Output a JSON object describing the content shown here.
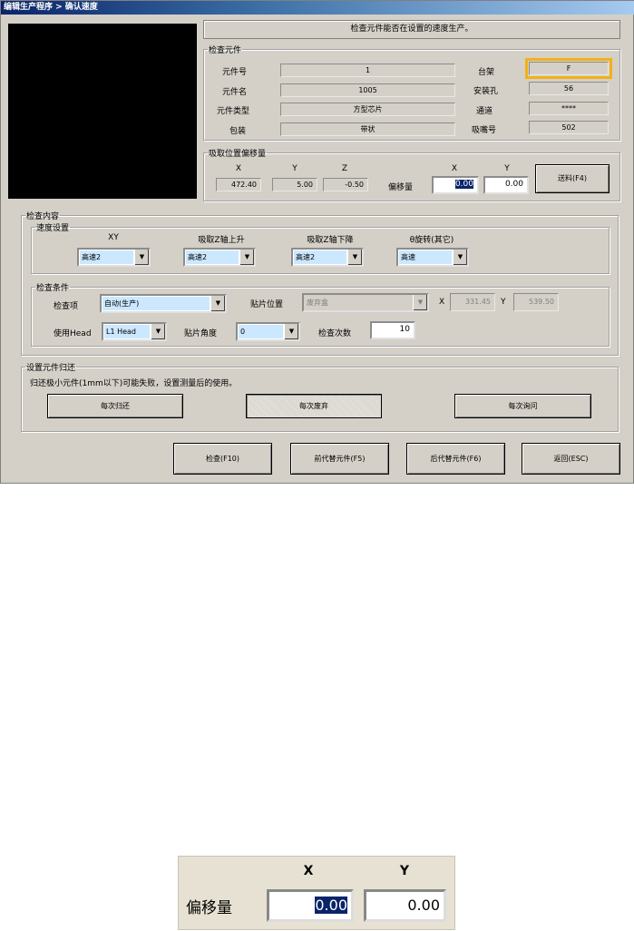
{
  "window": {
    "title": "编辑生产程序 > 确认速度"
  },
  "info_message": "检查元件能否在设置的速度生产。",
  "component": {
    "legend": "检查元件",
    "part_no_label": "元件号",
    "part_no": "1",
    "part_name_label": "元件名",
    "part_name": "1005",
    "part_type_label": "元件类型",
    "part_type": "方型芯片",
    "package_label": "包装",
    "package": "带状",
    "rack_label": "台架",
    "rack": "F",
    "hole_label": "安装孔",
    "hole": "56",
    "channel_label": "通道",
    "channel": "****",
    "nozzle_label": "吸嘴号",
    "nozzle": "502"
  },
  "pick_offset": {
    "legend": "吸取位置偏移量",
    "x_label": "X",
    "x": "472.40",
    "y_label": "Y",
    "y": "5.00",
    "z_label": "Z",
    "z": "-0.50",
    "offset_label": "偏移量",
    "offset_x_label": "X",
    "offset_x": "0.00",
    "offset_y_label": "Y",
    "offset_y": "0.00",
    "feed_button": "送料(F4)"
  },
  "inspect": {
    "legend": "检查内容",
    "speed": {
      "legend": "速度设置",
      "xy_label": "XY",
      "xy_value": "高速2",
      "z_up_label": "吸取Z轴上升",
      "z_up_value": "高速2",
      "z_down_label": "吸取Z轴下降",
      "z_down_value": "高速2",
      "theta_label": "θ旋转(其它)",
      "theta_value": "高速"
    },
    "conditions": {
      "legend": "检查条件",
      "item_label": "检查项",
      "item_value": "自动(生产)",
      "place_label": "贴片位置",
      "place_value": "废弃盒",
      "px_label": "X",
      "px": "331.45",
      "py_label": "Y",
      "py": "539.50",
      "head_label": "使用Head",
      "head_value": "L1 Head",
      "angle_label": "贴片角度",
      "angle_value": "0",
      "count_label": "检查次数",
      "count": "10"
    }
  },
  "return": {
    "legend": "设置元件归还",
    "note": "归还极小元件(1mm以下)可能失败，设置测量后的使用。",
    "btn_each_return": "每次归还",
    "btn_each_discard": "每次废弃",
    "btn_each_ask": "每次询问"
  },
  "footer": {
    "check": "检查(F10)",
    "prev": "前代替元件(F5)",
    "next": "后代替元件(F6)",
    "back": "返回(ESC)"
  },
  "zoom": {
    "x_label": "X",
    "y_label": "Y",
    "offset_label": "偏移量",
    "x": "0.00",
    "y": "0.00"
  }
}
